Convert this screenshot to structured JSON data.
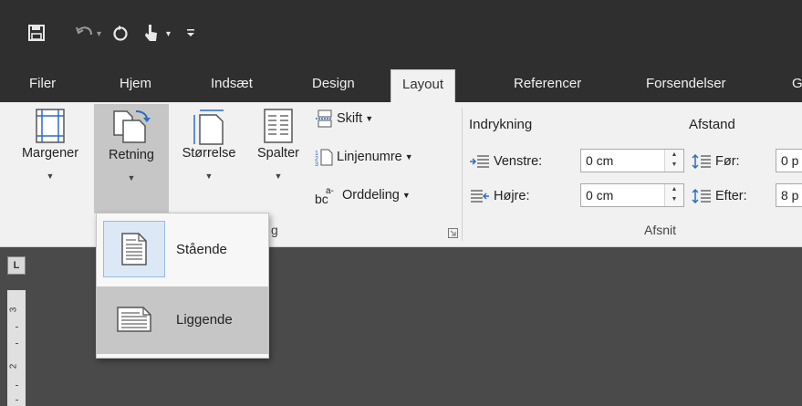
{
  "quick_access": {
    "save_icon": "save-icon",
    "undo_icon": "undo-icon",
    "redo_icon": "redo-icon",
    "touch_icon": "touch-mode-icon",
    "customize_icon": "customize-qat-icon"
  },
  "tabs": [
    {
      "label": "Filer"
    },
    {
      "label": "Hjem"
    },
    {
      "label": "Indsæt"
    },
    {
      "label": "Design"
    },
    {
      "label": "Layout"
    },
    {
      "label": "Referencer"
    },
    {
      "label": "Forsendelser"
    },
    {
      "label": "G"
    }
  ],
  "active_tab": "Layout",
  "page_setup": {
    "margins_label": "Margener",
    "orientation_label": "Retning",
    "size_label": "Størrelse",
    "columns_label": "Spalter",
    "breaks_label": "Skift",
    "line_numbers_label": "Linjenumre",
    "hyphenation_label": "Orddeling",
    "group_label_partial": "g"
  },
  "paragraph": {
    "indent_header": "Indrykning",
    "spacing_header": "Afstand",
    "left_label": "Venstre:",
    "left_value": "0 cm",
    "right_label": "Højre:",
    "right_value": "0 cm",
    "before_label": "Før:",
    "before_value": "0 p",
    "after_label": "Efter:",
    "after_value": "8 p",
    "group_label": "Afsnit"
  },
  "orientation_menu": {
    "items": [
      {
        "label": "Stående",
        "icon": "portrait-page-icon"
      },
      {
        "label": "Liggende",
        "icon": "landscape-page-icon"
      }
    ]
  },
  "ruler": {
    "corner_label": "L",
    "marks": [
      "3",
      "2"
    ]
  },
  "colors": {
    "titlebar": "#2f2f2f",
    "ribbon": "#f1f1f1",
    "document_bg": "#4a4a4a",
    "accent_blue": "#2b6cc4"
  }
}
